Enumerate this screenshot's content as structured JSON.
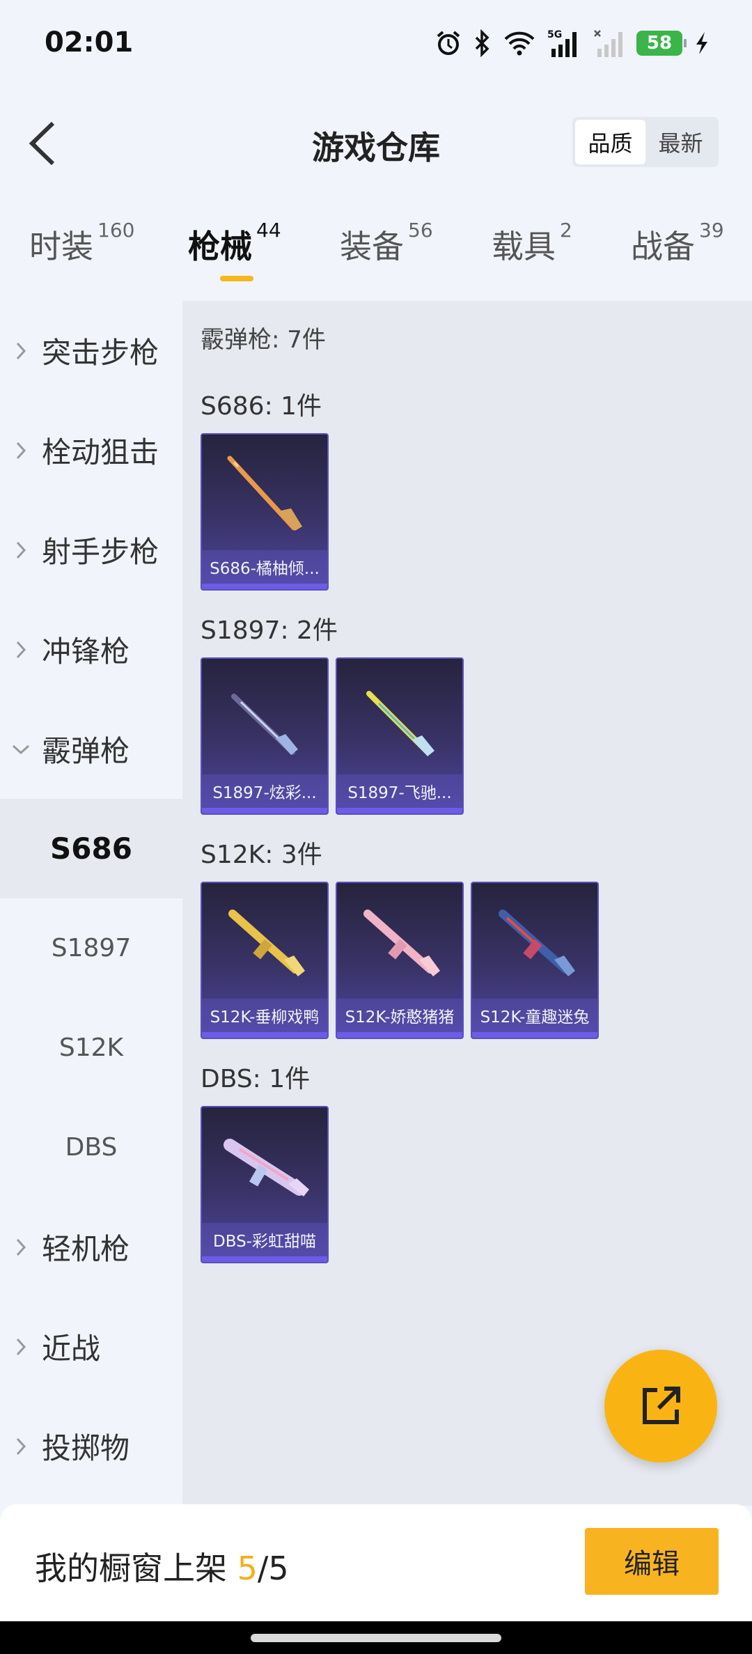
{
  "status_bar": {
    "time": "02:01",
    "network": "5G",
    "battery": "58",
    "icons": [
      "alarm-icon",
      "bluetooth-icon",
      "wifi-icon",
      "cell-signal-icon",
      "cell-signal-nosim-icon",
      "battery-icon",
      "charging-icon"
    ]
  },
  "header": {
    "title": "游戏仓库",
    "sort": [
      "品质",
      "最新"
    ],
    "active_sort": "品质"
  },
  "tabs": [
    {
      "label": "时装",
      "count": "160"
    },
    {
      "label": "枪械",
      "count": "44"
    },
    {
      "label": "装备",
      "count": "56"
    },
    {
      "label": "载具",
      "count": "2"
    },
    {
      "label": "战备",
      "count": "39"
    }
  ],
  "active_tab": "枪械",
  "sidebar": {
    "categories": [
      "突击步枪",
      "栓动狙击",
      "射手步枪",
      "冲锋枪",
      "霰弹枪",
      "轻机枪",
      "近战",
      "投掷物"
    ],
    "expanded": "霰弹枪",
    "subitems": [
      "S686",
      "S1897",
      "S12K",
      "DBS"
    ],
    "active_subitem": "S686"
  },
  "content": {
    "total": "霰弹枪: 7件",
    "groups": [
      {
        "title": "S686: 1件",
        "items": [
          "S686-橘柚倾..."
        ]
      },
      {
        "title": "S1897: 2件",
        "items": [
          "S1897-炫彩...",
          "S1897-飞驰..."
        ]
      },
      {
        "title": "S12K: 3件",
        "items": [
          "S12K-垂柳戏鸭",
          "S12K-娇憨猪猪",
          "S12K-童趣迷兔"
        ]
      },
      {
        "title": "DBS: 1件",
        "items": [
          "DBS-彩虹甜喵"
        ]
      }
    ]
  },
  "bottom": {
    "shelf_label": "我的橱窗上架",
    "shelf_count": "5",
    "shelf_total": "/5",
    "edit_label": "编辑"
  },
  "colors": {
    "accent": "#f8b420",
    "card_bg": "#3a3367",
    "card_border": "#5a4fbf"
  }
}
